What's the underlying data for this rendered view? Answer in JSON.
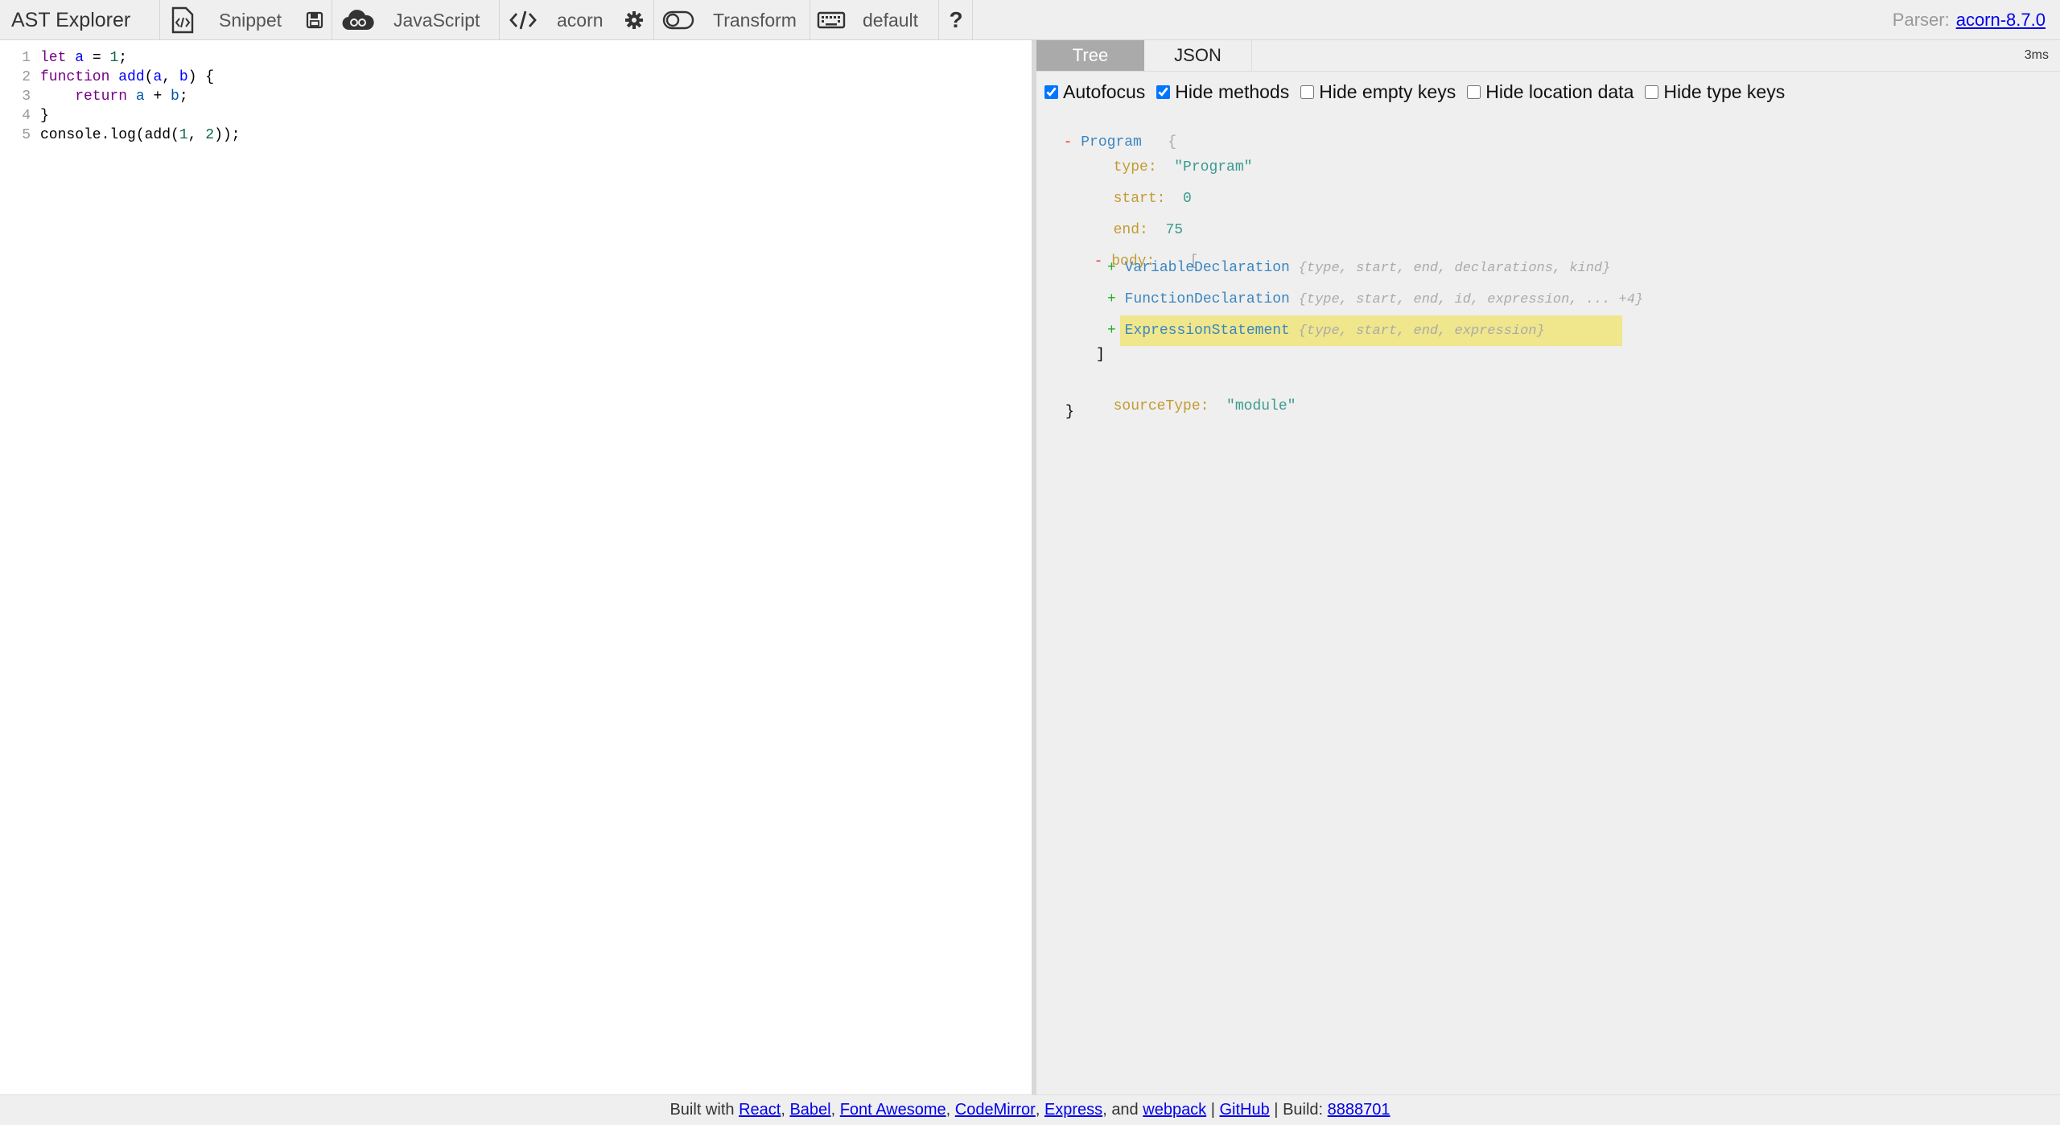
{
  "toolbar": {
    "title": "AST Explorer",
    "snippet_label": "Snippet",
    "language_label": "JavaScript",
    "parser_label": "acorn",
    "transform_label": "Transform",
    "keymap_label": "default",
    "parser_prefix": "Parser:",
    "parser_version": "acorn-8.7.0"
  },
  "editor": {
    "lines": [
      {
        "n": "1",
        "tokens": [
          {
            "t": "let ",
            "c": "kw"
          },
          {
            "t": "a",
            "c": "def"
          },
          {
            "t": " = ",
            "c": "plain"
          },
          {
            "t": "1",
            "c": "num"
          },
          {
            "t": ";",
            "c": "plain"
          }
        ]
      },
      {
        "n": "2",
        "tokens": [
          {
            "t": "function ",
            "c": "kw"
          },
          {
            "t": "add",
            "c": "def"
          },
          {
            "t": "(",
            "c": "plain"
          },
          {
            "t": "a",
            "c": "def"
          },
          {
            "t": ", ",
            "c": "plain"
          },
          {
            "t": "b",
            "c": "def"
          },
          {
            "t": ") {",
            "c": "plain"
          }
        ]
      },
      {
        "n": "3",
        "tokens": [
          {
            "t": "    return ",
            "c": "kw"
          },
          {
            "t": "a",
            "c": "var2"
          },
          {
            "t": " + ",
            "c": "plain"
          },
          {
            "t": "b",
            "c": "var2"
          },
          {
            "t": ";",
            "c": "plain"
          }
        ]
      },
      {
        "n": "4",
        "tokens": [
          {
            "t": "}",
            "c": "plain"
          }
        ]
      },
      {
        "n": "5",
        "tokens": [
          {
            "t": "console.log(add(",
            "c": "plain"
          },
          {
            "t": "1",
            "c": "num"
          },
          {
            "t": ", ",
            "c": "plain"
          },
          {
            "t": "2",
            "c": "num"
          },
          {
            "t": "));",
            "c": "plain"
          }
        ]
      }
    ]
  },
  "output": {
    "tabs": [
      "Tree",
      "JSON"
    ],
    "time": "3ms",
    "options": [
      {
        "label": "Autofocus",
        "checked": true
      },
      {
        "label": "Hide methods",
        "checked": true
      },
      {
        "label": "Hide empty keys",
        "checked": false
      },
      {
        "label": "Hide location data",
        "checked": false
      },
      {
        "label": "Hide type keys",
        "checked": false
      }
    ],
    "tree": {
      "root_toggle": "-",
      "root": "Program",
      "open_brace": "{",
      "type_key": "type:",
      "type_val": "\"Program\"",
      "start_key": "start:",
      "start_val": "0",
      "end_key": "end:",
      "end_val": "75",
      "body_toggle": "-",
      "body_key": "body:",
      "open_bracket": "[",
      "close_bracket": "]",
      "expand": "+",
      "children": [
        {
          "name": "VariableDeclaration",
          "summary": "{type, start, end, declarations, kind}"
        },
        {
          "name": "FunctionDeclaration",
          "summary": "{type, start, end, id, expression, ... +4}"
        },
        {
          "name": "ExpressionStatement",
          "summary": "{type, start, end, expression}"
        }
      ],
      "sourceType_key": "sourceType:",
      "sourceType_val": "\"module\"",
      "close_brace": "}"
    }
  },
  "footer": {
    "built_with": "Built with",
    "links": [
      "React",
      "Babel",
      "Font Awesome",
      "CodeMirror",
      "Express",
      "webpack"
    ],
    "and": "and",
    "github": "GitHub",
    "build_prefix": "Build:",
    "build": "8888701"
  },
  "colors": {
    "highlight": "#f0e68c",
    "tab_active": "#aaaaaa",
    "toolbar_bg": "#efefef"
  }
}
